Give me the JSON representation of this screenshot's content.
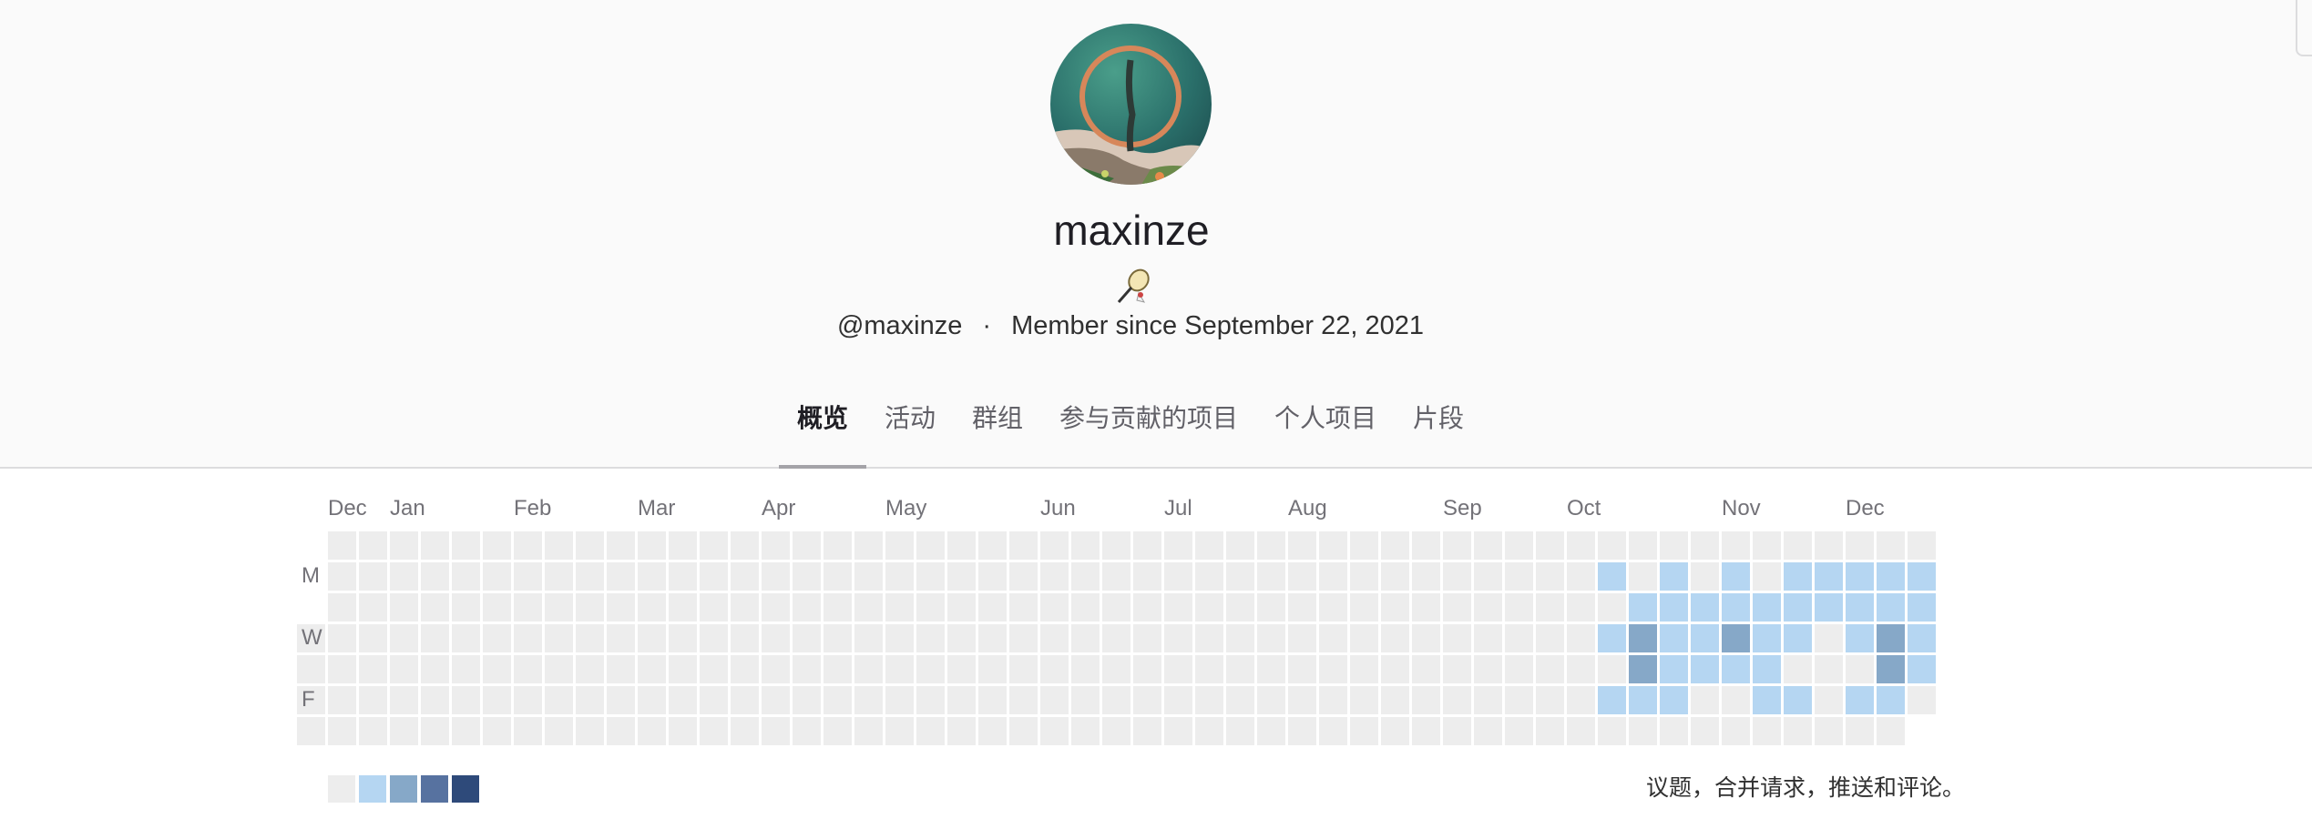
{
  "profile": {
    "name": "maxinze",
    "handle": "@maxinze",
    "separator": "·",
    "member_since": "Member since September 22, 2021",
    "avatar_icon": "beach-aerial-avatar",
    "status_icon": "badminton-racket-icon"
  },
  "tabs": [
    {
      "label": "概览",
      "active": true
    },
    {
      "label": "活动",
      "active": false
    },
    {
      "label": "群组",
      "active": false
    },
    {
      "label": "参与贡献的项目",
      "active": false
    },
    {
      "label": "个人项目",
      "active": false
    },
    {
      "label": "片段",
      "active": false
    }
  ],
  "calendar": {
    "months": [
      "Dec",
      "Jan",
      "Feb",
      "Mar",
      "Apr",
      "May",
      "Jun",
      "Jul",
      "Aug",
      "Sep",
      "Oct",
      "Nov",
      "Dec"
    ],
    "day_labels": [
      "M",
      "W",
      "F"
    ],
    "colors": {
      "empty": "#ededed",
      "level1": "#b5d6f2",
      "level2": "#86a8c8",
      "level3": "#5772a0",
      "level4": "#2e4a7a"
    },
    "summary": "议题，合并请求，推送和评论。"
  }
}
